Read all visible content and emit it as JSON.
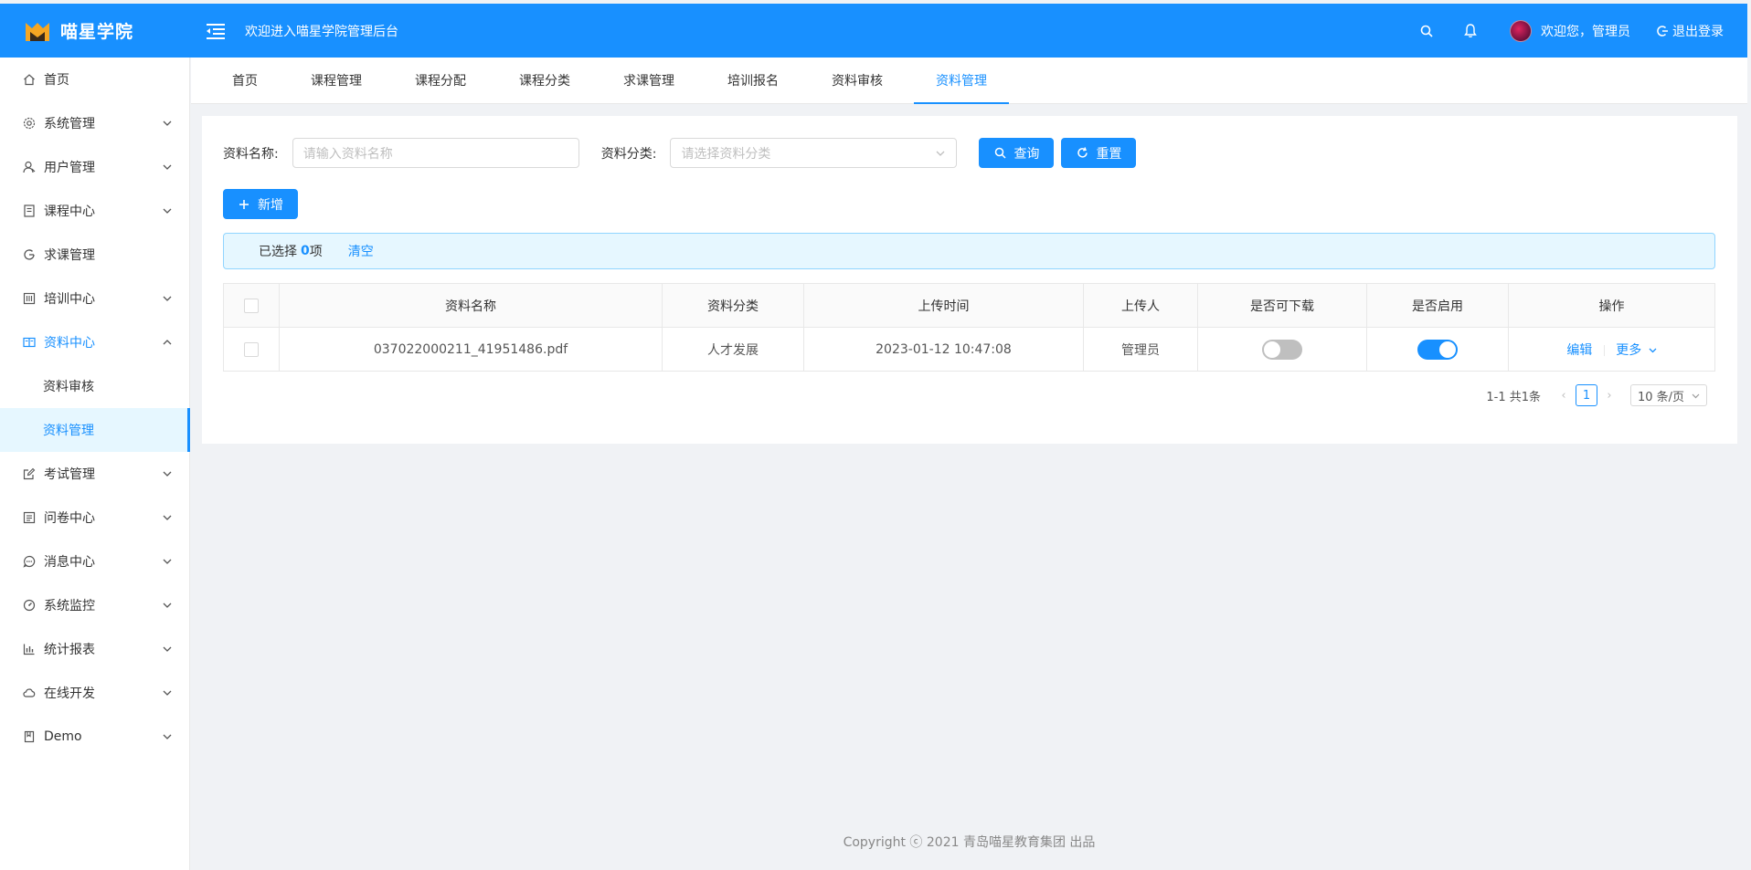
{
  "app": {
    "name": "喵星学院",
    "header_title": "欢迎进入喵星学院管理后台",
    "welcome": "欢迎您，管理员",
    "logout": "退出登录"
  },
  "sidebar": {
    "items": [
      {
        "label": "首页",
        "icon": "home-icon"
      },
      {
        "label": "系统管理",
        "icon": "settings-icon"
      },
      {
        "label": "用户管理",
        "icon": "user-icon"
      },
      {
        "label": "课程中心",
        "icon": "course-icon"
      },
      {
        "label": "求课管理",
        "icon": "request-icon"
      },
      {
        "label": "培训中心",
        "icon": "training-icon"
      },
      {
        "label": "资料中心",
        "icon": "book-icon"
      },
      {
        "label": "资料审核"
      },
      {
        "label": "资料管理"
      },
      {
        "label": "考试管理",
        "icon": "edit-icon"
      },
      {
        "label": "问卷中心",
        "icon": "survey-icon"
      },
      {
        "label": "消息中心",
        "icon": "message-icon"
      },
      {
        "label": "系统监控",
        "icon": "dashboard-icon"
      },
      {
        "label": "统计报表",
        "icon": "bar-chart-icon"
      },
      {
        "label": "在线开发",
        "icon": "cloud-icon"
      },
      {
        "label": "Demo",
        "icon": "bookmark-icon"
      }
    ]
  },
  "tabs": [
    "首页",
    "课程管理",
    "课程分配",
    "课程分类",
    "求课管理",
    "培训报名",
    "资料审核",
    "资料管理"
  ],
  "search": {
    "name_label": "资料名称:",
    "name_placeholder": "请输入资料名称",
    "category_label": "资料分类:",
    "category_placeholder": "请选择资料分类",
    "query_button": "查询",
    "reset_button": "重置"
  },
  "add_button": "新增",
  "alert": {
    "prefix": "已选择",
    "count": "0",
    "suffix": "项",
    "clear": "清空"
  },
  "table": {
    "columns": [
      "资料名称",
      "资料分类",
      "上传时间",
      "上传人",
      "是否可下载",
      "是否启用",
      "操作"
    ],
    "rows": [
      {
        "name": "037022000211_41951486.pdf",
        "category": "人才发展",
        "upload_time": "2023-01-12 10:47:08",
        "uploader": "管理员",
        "downloadable": false,
        "enabled": true,
        "edit": "编辑",
        "more": "更多"
      }
    ]
  },
  "pagination": {
    "total": "1-1 共1条",
    "current": "1",
    "page_size": "10 条/页"
  },
  "footer": "Copyright ⓒ 2021 青岛喵星教育集团 出品",
  "colors": {
    "primary": "#1890ff",
    "background": "#f0f2f5"
  }
}
